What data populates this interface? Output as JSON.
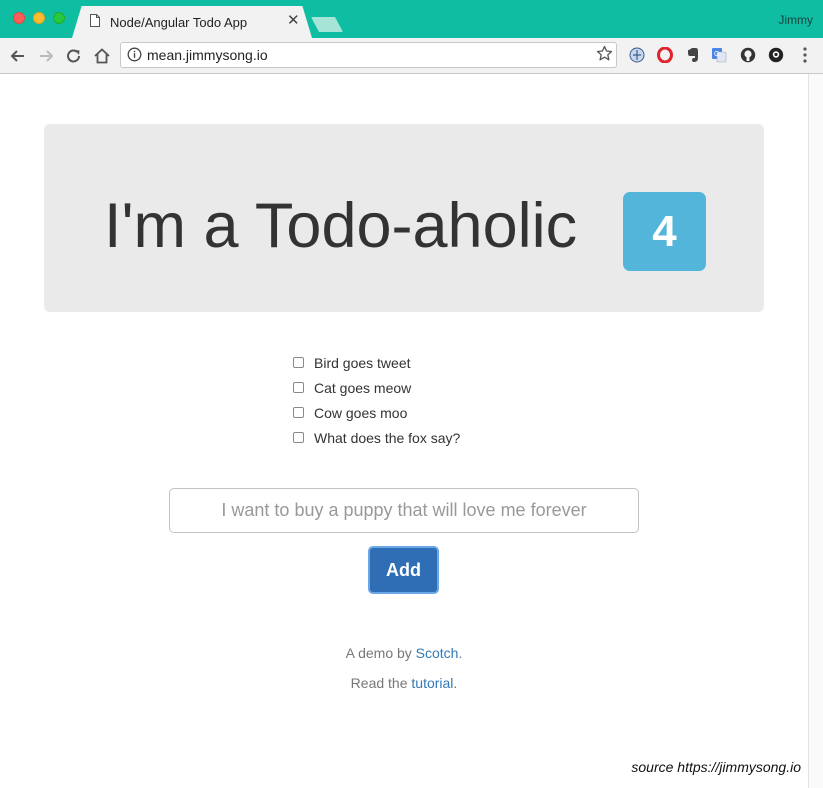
{
  "browser": {
    "tab_title": "Node/Angular Todo App",
    "profile_name": "Jimmy",
    "url": "mean.jimmysong.io",
    "accent_color": "#0fbea2",
    "extensions": [
      "translate-icon",
      "opera-icon",
      "evernote-icon",
      "google-translate-icon",
      "github-icon",
      "octotree-icon"
    ]
  },
  "page": {
    "heading": "I'm a Todo-aholic",
    "todo_count": "4",
    "todos": [
      {
        "text": "Bird goes tweet",
        "done": false
      },
      {
        "text": "Cat goes meow",
        "done": false
      },
      {
        "text": "Cow goes moo",
        "done": false
      },
      {
        "text": "What does the fox say?",
        "done": false
      }
    ],
    "input_placeholder": "I want to buy a puppy that will love me forever",
    "add_label": "Add",
    "footer": {
      "demo_prefix": "A demo by ",
      "demo_link": "Scotch",
      "demo_suffix": ".",
      "read_prefix": "Read the ",
      "read_link": "tutorial",
      "read_suffix": "."
    },
    "source_caption": "source https://jimmysong.io",
    "badge_color": "#53b5d9",
    "button_color": "#2f6db5"
  }
}
